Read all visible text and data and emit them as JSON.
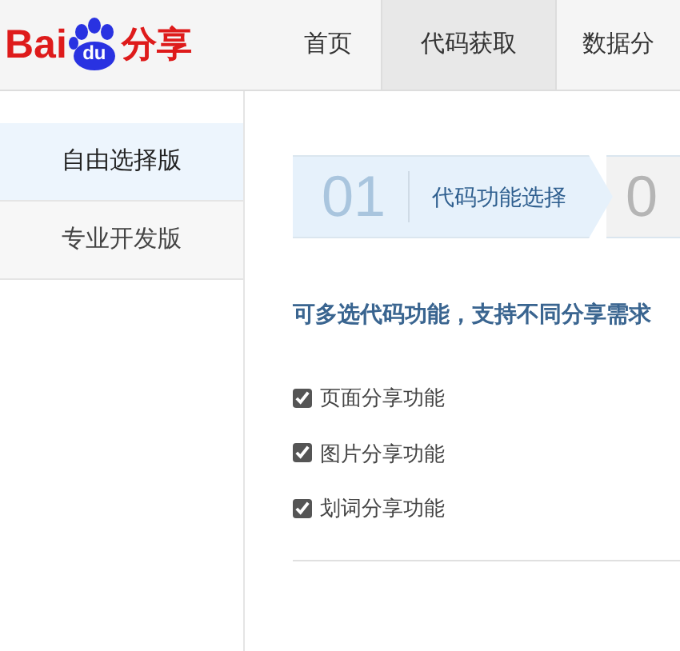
{
  "logo": {
    "text_left": "Bai",
    "paw_text": "du",
    "text_right": "分享"
  },
  "nav": [
    {
      "label": "首页",
      "selected": false
    },
    {
      "label": "代码获取",
      "selected": true
    },
    {
      "label": "数据分",
      "selected": false
    }
  ],
  "sidebar": {
    "items": [
      {
        "label": "自由选择版",
        "selected": true
      },
      {
        "label": "专业开发版",
        "selected": false
      }
    ]
  },
  "steps": [
    {
      "number": "01",
      "label": "代码功能选择",
      "selected": true
    },
    {
      "number": "0",
      "selected": false
    }
  ],
  "heading": "可多选代码功能，支持不同分享需求",
  "options": [
    {
      "label": "页面分享功能",
      "checked": true
    },
    {
      "label": "图片分享功能",
      "checked": true
    },
    {
      "label": "划词分享功能",
      "checked": true
    }
  ]
}
